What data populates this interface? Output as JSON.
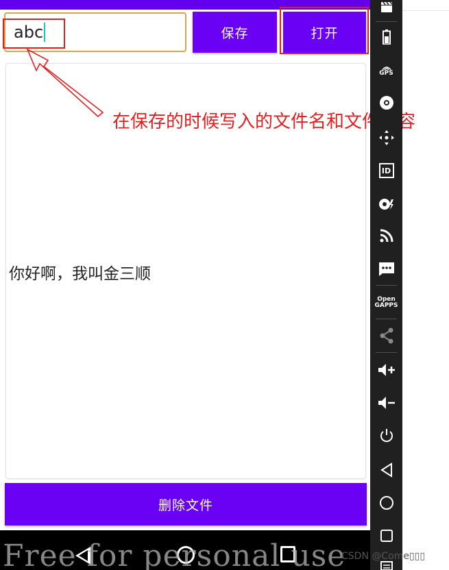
{
  "app": {
    "filename_value": "abc",
    "save_label": "保存",
    "open_label": "打开",
    "content_text": "你好啊，我叫金三顺",
    "delete_label": "删除文件"
  },
  "annotation": {
    "text": "在保存的时候写入的文件名和文件内容",
    "color": "#e02020"
  },
  "colors": {
    "accent": "#6200ee",
    "button": "#6a00f4",
    "input_focus_border": "#d8a64a"
  },
  "emulator_toolbar": {
    "gps_label": "GPS",
    "id_label": "ID",
    "open_gapps_label": "Open\nGAPPS",
    "icons": [
      "clapper-icon",
      "battery-icon",
      "gps-icon",
      "camera-icon",
      "move-icon",
      "id-icon",
      "disc-icon",
      "rss-icon",
      "sms-icon",
      "open-gapps-icon",
      "share-icon",
      "volume-up-icon",
      "volume-down-icon",
      "power-icon",
      "back-icon",
      "home-icon",
      "overview-icon",
      "menu-icon"
    ]
  },
  "watermark": "Free for personal use",
  "credit": "CSDN @Come▯▯▯"
}
